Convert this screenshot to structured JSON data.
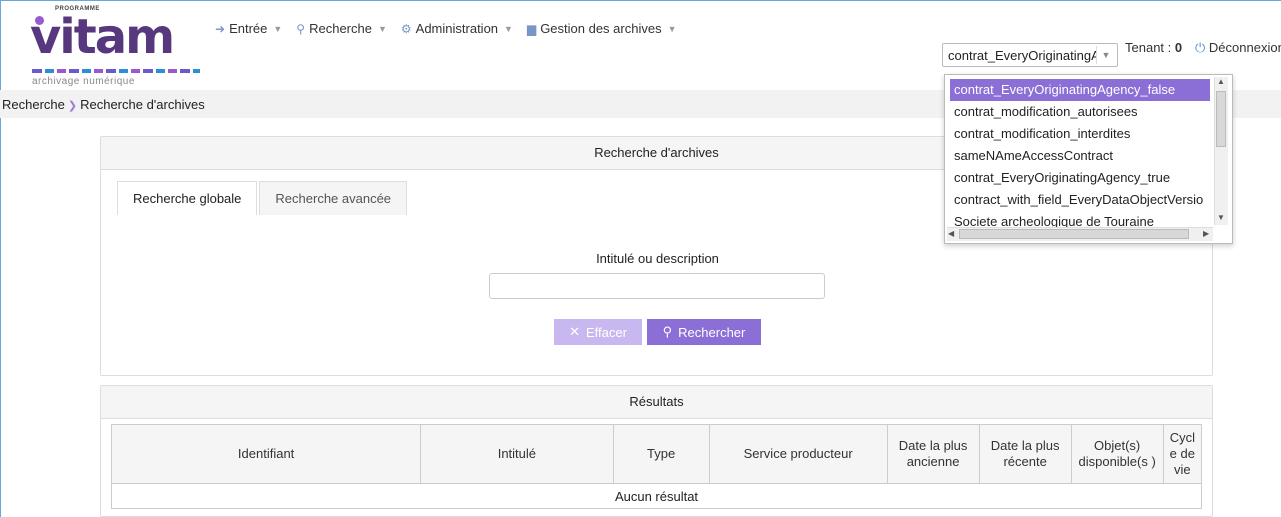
{
  "logo": {
    "program": "PROGRAMME",
    "word": "vitam",
    "subtitle": "archivage numérique"
  },
  "nav": [
    {
      "label": "Entrée",
      "icon": "login-icon",
      "glyph": "➜"
    },
    {
      "label": "Recherche",
      "icon": "search-icon",
      "glyph": "⚲"
    },
    {
      "label": "Administration",
      "icon": "gears-icon",
      "glyph": "⚙"
    },
    {
      "label": "Gestion des archives",
      "icon": "chart-icon",
      "glyph": "▆"
    }
  ],
  "contract": {
    "selected": "contrat_EveryOriginatingAgency_false"
  },
  "contract_options": [
    "contrat_EveryOriginatingAgency_false",
    "contrat_modification_autorisees",
    "contrat_modification_interdites",
    "sameNAmeAccessContract",
    "contrat_EveryOriginatingAgency_true",
    "contract_with_field_EveryDataObjectVersio",
    "Societe archeologique de Touraine"
  ],
  "tenant": {
    "label": "Tenant :",
    "value": "0"
  },
  "logout": {
    "label": "Déconnexion"
  },
  "breadcrumb": {
    "root": "Recherche",
    "current": "Recherche d'archives"
  },
  "search_panel": {
    "title": "Recherche d'archives",
    "tabs": [
      "Recherche globale",
      "Recherche avancée"
    ],
    "field_label": "Intitulé ou description",
    "field_value": "",
    "clear_label": "Effacer",
    "search_label": "Rechercher"
  },
  "results_panel": {
    "title": "Résultats",
    "columns": [
      "Identifiant",
      "Intitulé",
      "Type",
      "Service producteur",
      "Date la plus ancienne",
      "Date la plus récente",
      "Objet(s) disponible(s )",
      "Cycl e de vie"
    ],
    "empty": "Aucun résultat"
  },
  "colors": {
    "accent": "#8b6fd6",
    "accent_light": "#c9b8f0",
    "brand": "#57377e"
  }
}
